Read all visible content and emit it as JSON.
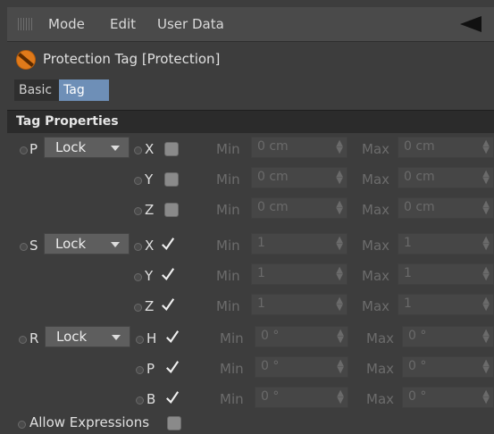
{
  "menubar": {
    "items": [
      "Mode",
      "Edit",
      "User Data"
    ]
  },
  "header": {
    "title": "Protection Tag [Protection]"
  },
  "tabs": [
    {
      "label": "Basic",
      "active": false
    },
    {
      "label": "Tag",
      "active": true
    }
  ],
  "section": {
    "title": "Tag Properties"
  },
  "min_label": "Min",
  "max_label": "Max",
  "groups": [
    {
      "label": "P",
      "mode": "Lock",
      "axes": [
        {
          "axis": "X",
          "checked": false,
          "min": "0 cm",
          "max": "0 cm"
        },
        {
          "axis": "Y",
          "checked": false,
          "min": "0 cm",
          "max": "0 cm"
        },
        {
          "axis": "Z",
          "checked": false,
          "min": "0 cm",
          "max": "0 cm"
        }
      ]
    },
    {
      "label": "S",
      "mode": "Lock",
      "axes": [
        {
          "axis": "X",
          "checked": true,
          "min": "1",
          "max": "1"
        },
        {
          "axis": "Y",
          "checked": true,
          "min": "1",
          "max": "1"
        },
        {
          "axis": "Z",
          "checked": true,
          "min": "1",
          "max": "1"
        }
      ]
    },
    {
      "label": "R",
      "mode": "Lock",
      "axes": [
        {
          "axis": "H",
          "checked": true,
          "min": "0 °",
          "max": "0 °"
        },
        {
          "axis": "P",
          "checked": true,
          "min": "0 °",
          "max": "0 °"
        },
        {
          "axis": "B",
          "checked": true,
          "min": "0 °",
          "max": "0 °"
        }
      ]
    }
  ],
  "allow_expressions": {
    "label": "Allow Expressions",
    "checked": false
  }
}
